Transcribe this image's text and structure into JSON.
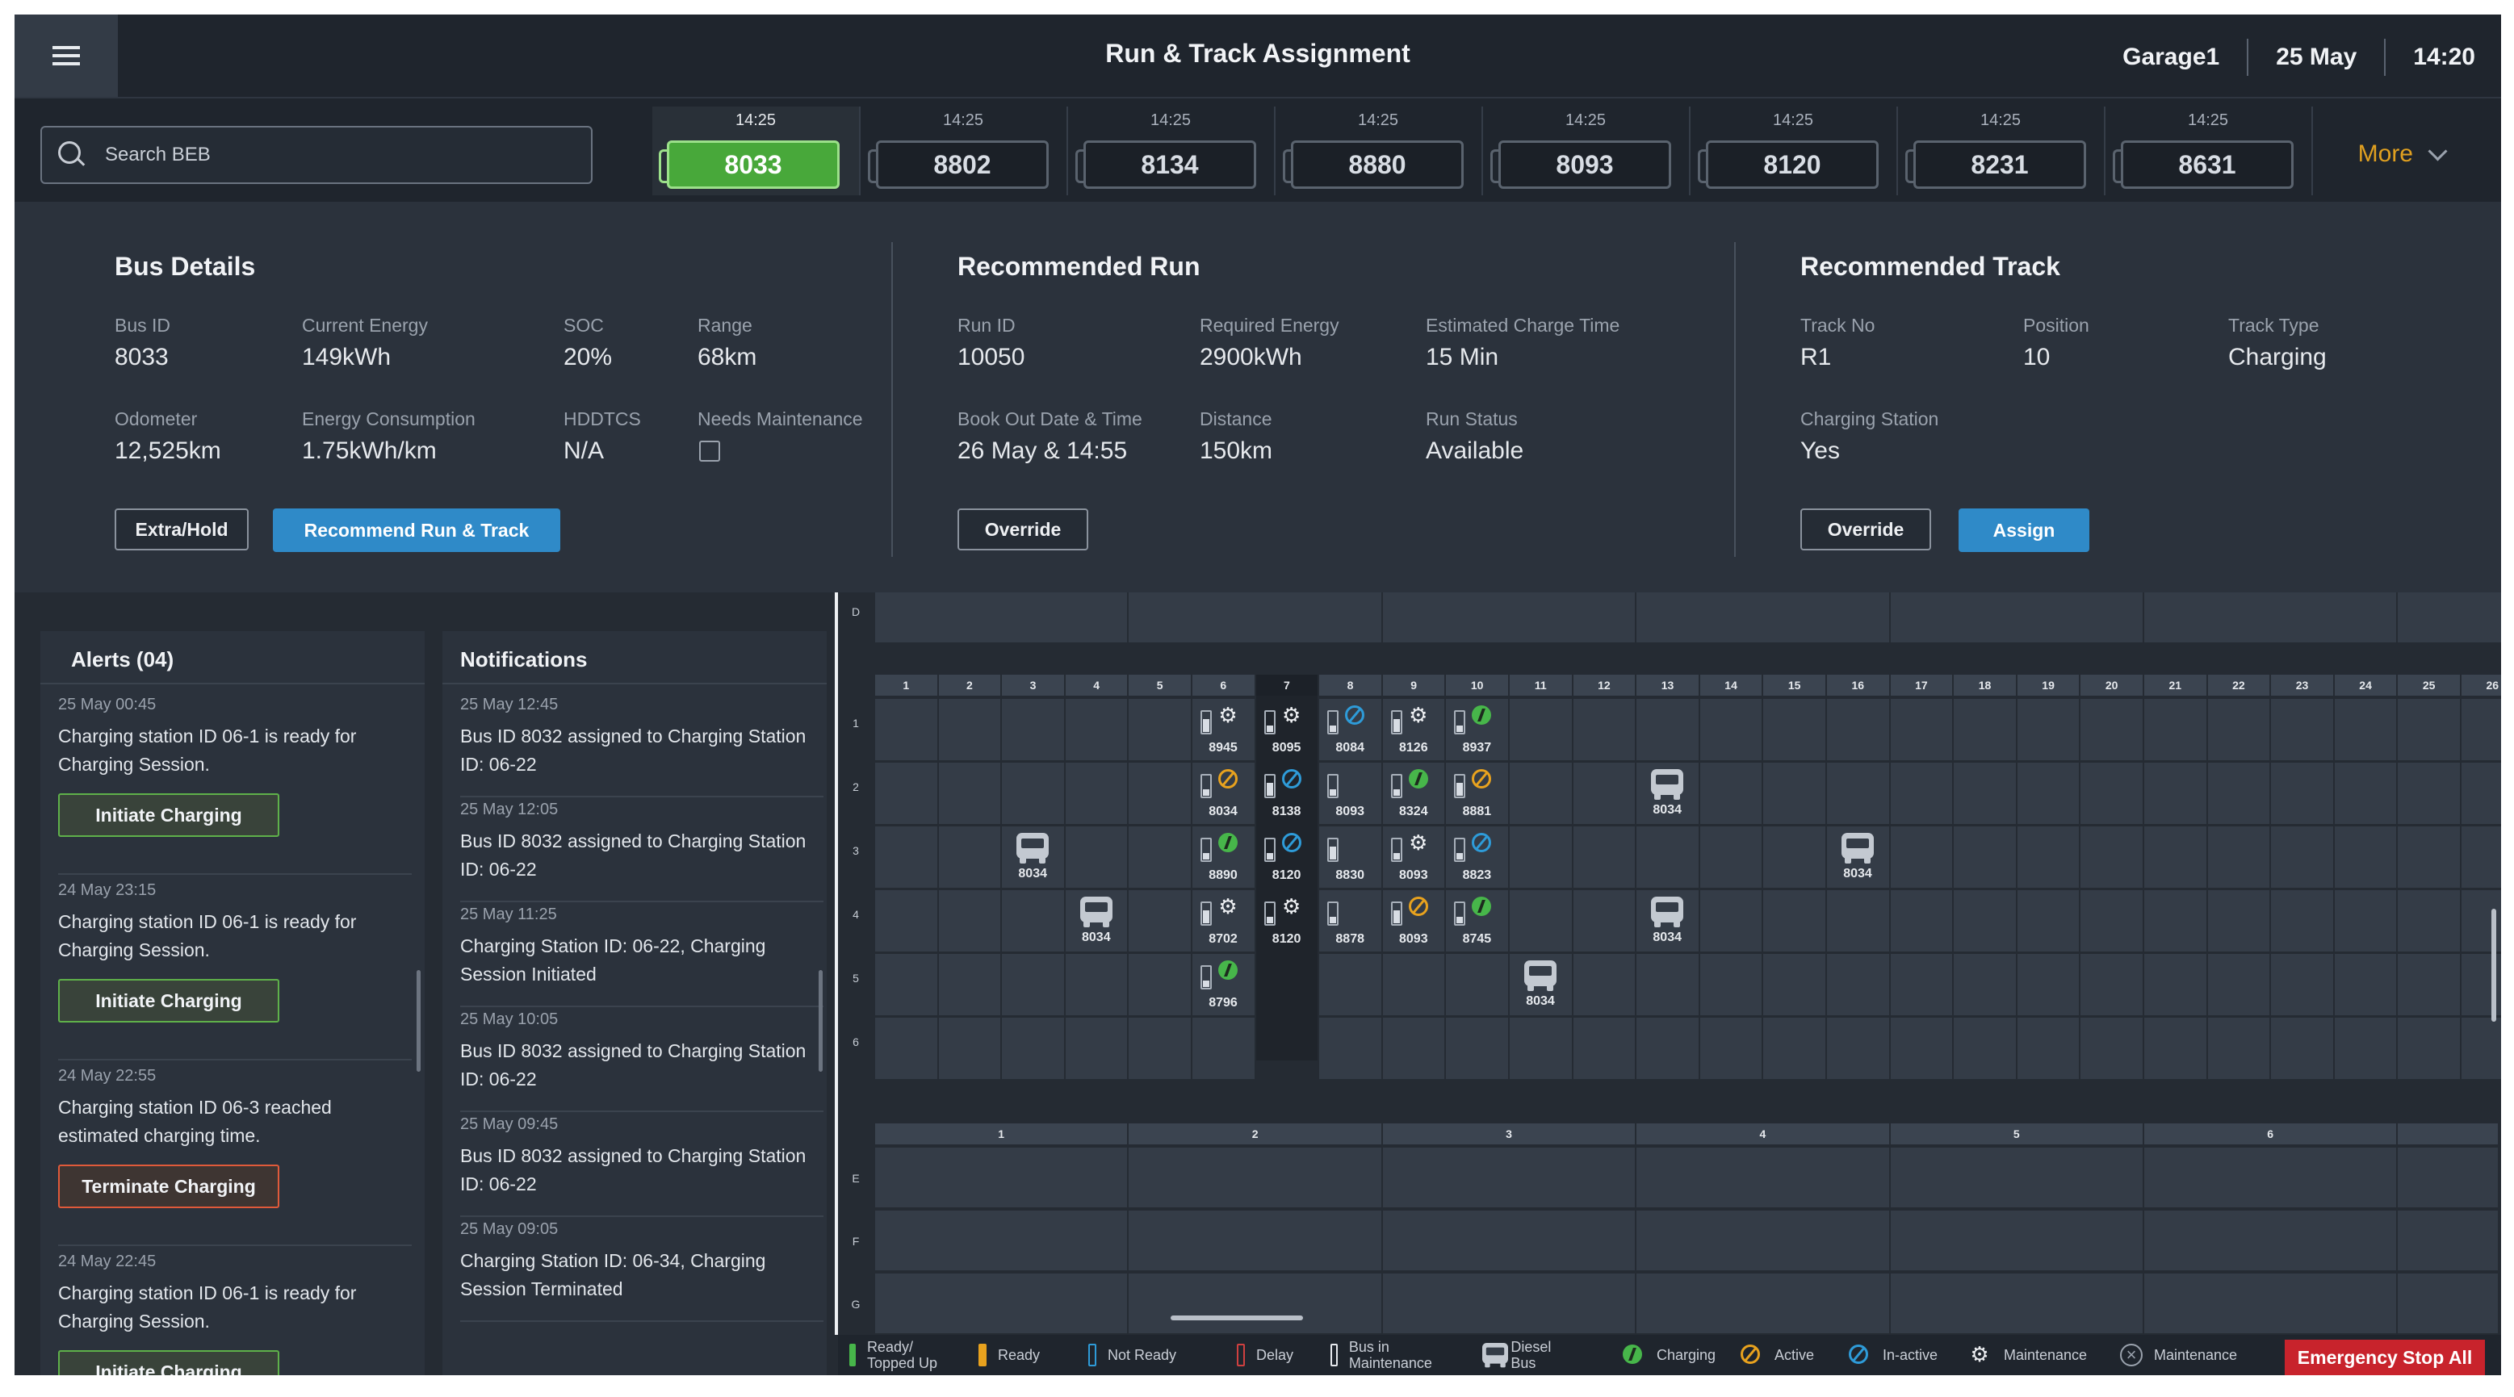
{
  "header": {
    "title": "Run & Track Assignment",
    "garage": "Garage1",
    "date": "25 May",
    "time": "14:20"
  },
  "search": {
    "placeholder": "Search BEB"
  },
  "bus_strip": {
    "buses": [
      {
        "time": "14:25",
        "id": "8033",
        "selected": true
      },
      {
        "time": "14:25",
        "id": "8802"
      },
      {
        "time": "14:25",
        "id": "8134"
      },
      {
        "time": "14:25",
        "id": "8880"
      },
      {
        "time": "14:25",
        "id": "8093"
      },
      {
        "time": "14:25",
        "id": "8120"
      },
      {
        "time": "14:25",
        "id": "8231"
      },
      {
        "time": "14:25",
        "id": "8631"
      }
    ],
    "more_label": "More"
  },
  "bus_details": {
    "title": "Bus Details",
    "fields": [
      {
        "label": "Bus ID",
        "value": "8033"
      },
      {
        "label": "Current Energy",
        "value": "149kWh"
      },
      {
        "label": "SOC",
        "value": "20%"
      },
      {
        "label": "Range",
        "value": "68km"
      },
      {
        "label": "Odometer",
        "value": "12,525km"
      },
      {
        "label": "Energy Consumption",
        "value": "1.75kWh/km"
      },
      {
        "label": "HDDTCS",
        "value": "N/A"
      },
      {
        "label": "Needs Maintenance",
        "value": ""
      }
    ],
    "extra_hold_label": "Extra/Hold",
    "recommend_label": "Recommend Run & Track"
  },
  "recommended_run": {
    "title": "Recommended Run",
    "fields": [
      {
        "label": "Run ID",
        "value": "10050"
      },
      {
        "label": "Required Energy",
        "value": "2900kWh"
      },
      {
        "label": "Estimated Charge Time",
        "value": "15 Min"
      },
      {
        "label": "Book Out Date & Time",
        "value": "26 May & 14:55"
      },
      {
        "label": "Distance",
        "value": "150km"
      },
      {
        "label": "Run Status",
        "value": "Available"
      }
    ],
    "override_label": "Override"
  },
  "recommended_track": {
    "title": "Recommended Track",
    "fields": [
      {
        "label": "Track No",
        "value": "R1"
      },
      {
        "label": "Position",
        "value": "10"
      },
      {
        "label": "Track Type",
        "value": "Charging"
      },
      {
        "label": "Charging Station",
        "value": "Yes"
      }
    ],
    "override_label": "Override",
    "assign_label": "Assign"
  },
  "alerts": {
    "title": "Alerts (04)",
    "items": [
      {
        "time": "25 May 00:45",
        "message": "Charging station ID 06-1 is ready for Charging Session.",
        "action": "Initiate Charging"
      },
      {
        "time": "24 May 23:15",
        "message": "Charging station ID 06-1 is ready for Charging Session.",
        "action": "Initiate Charging"
      },
      {
        "time": "24 May 22:55",
        "message": "Charging station ID 06-3 reached estimated charging time.",
        "action": "Terminate Charging"
      },
      {
        "time": "24 May 22:45",
        "message": "Charging station ID 06-1 is ready for Charging Session.",
        "action": "Initiate Charging"
      }
    ]
  },
  "notifications": {
    "title": "Notifications",
    "items": [
      {
        "time": "25 May 12:45",
        "message": "Bus ID 8032 assigned to Charging Station ID: 06-22"
      },
      {
        "time": "25 May 12:05",
        "message": "Bus ID 8032 assigned to Charging Station ID: 06-22"
      },
      {
        "time": "25 May 11:25",
        "message": "Charging Station ID: 06-22, Charging Session Initiated"
      },
      {
        "time": "25 May 10:05",
        "message": "Bus ID 8032 assigned to Charging Station ID: 06-22"
      },
      {
        "time": "25 May 09:45",
        "message": "Bus ID 8032 assigned to Charging Station ID: 06-22"
      },
      {
        "time": "25 May 09:05",
        "message": "Charging Station ID: 06-34, Charging Session Terminated"
      }
    ]
  },
  "yard": {
    "top_row_label": "D",
    "columns": [
      "1",
      "2",
      "3",
      "4",
      "5",
      "6",
      "7",
      "8",
      "9",
      "10",
      "11",
      "12",
      "13",
      "14",
      "15",
      "16",
      "17",
      "18",
      "19",
      "20",
      "21",
      "22",
      "23",
      "24",
      "25",
      "26"
    ],
    "highlight_column": "7",
    "rows": [
      "1",
      "2",
      "3",
      "4",
      "5",
      "6"
    ],
    "lower_columns": [
      "1",
      "2",
      "3",
      "4",
      "5",
      "6"
    ],
    "lower_rows": [
      "E",
      "F",
      "G"
    ],
    "buses": [
      {
        "id": "8945",
        "row": 1,
        "col": 6,
        "status": "maintenance"
      },
      {
        "id": "8095",
        "row": 1,
        "col": 7,
        "status": "maintenance"
      },
      {
        "id": "8084",
        "row": 1,
        "col": 8,
        "status": "inactive"
      },
      {
        "id": "8126",
        "row": 1,
        "col": 9,
        "status": "maintenance"
      },
      {
        "id": "8937",
        "row": 1,
        "col": 10,
        "status": "charging"
      },
      {
        "id": "8034",
        "row": 2,
        "col": 6,
        "status": "active"
      },
      {
        "id": "8138",
        "row": 2,
        "col": 7,
        "status": "inactive"
      },
      {
        "id": "8093",
        "row": 2,
        "col": 8,
        "status": ""
      },
      {
        "id": "8324",
        "row": 2,
        "col": 9,
        "status": "charging"
      },
      {
        "id": "8881",
        "row": 2,
        "col": 10,
        "status": "active"
      },
      {
        "id": "8890",
        "row": 3,
        "col": 6,
        "status": "charging"
      },
      {
        "id": "8120",
        "row": 3,
        "col": 7,
        "status": "inactive"
      },
      {
        "id": "8830",
        "row": 3,
        "col": 8,
        "status": ""
      },
      {
        "id": "8093",
        "row": 3,
        "col": 9,
        "status": "maintenance"
      },
      {
        "id": "8823",
        "row": 3,
        "col": 10,
        "status": "inactive"
      },
      {
        "id": "8702",
        "row": 4,
        "col": 6,
        "status": "maintenance"
      },
      {
        "id": "8120",
        "row": 4,
        "col": 7,
        "status": "maintenance"
      },
      {
        "id": "8878",
        "row": 4,
        "col": 8,
        "status": ""
      },
      {
        "id": "8093",
        "row": 4,
        "col": 9,
        "status": "active"
      },
      {
        "id": "8745",
        "row": 4,
        "col": 10,
        "status": "charging"
      },
      {
        "id": "8796",
        "row": 5,
        "col": 6,
        "status": "charging"
      }
    ],
    "diesel_buses": [
      {
        "id": "8034",
        "row": 2,
        "col": 13
      },
      {
        "id": "8034",
        "row": 3,
        "col": 3
      },
      {
        "id": "8034",
        "row": 3,
        "col": 16
      },
      {
        "id": "8034",
        "row": 4,
        "col": 4
      },
      {
        "id": "8034",
        "row": 4,
        "col": 13
      },
      {
        "id": "8034",
        "row": 5,
        "col": 11
      }
    ]
  },
  "legend": {
    "ready_topped": "Ready/ Topped Up",
    "ready": "Ready",
    "not_ready": "Not Ready",
    "delay": "Delay",
    "bus_maintenance": "Bus in Maintenance",
    "diesel": "Diesel Bus",
    "charging": "Charging",
    "active": "Active",
    "inactive": "In-active",
    "maintenance": "Maintenance",
    "maintenance2": "Maintenance",
    "emergency_stop": "Emergency Stop All"
  },
  "colors": {
    "accent_blue": "#2f8ac8",
    "ready_green": "#47b64a",
    "active_amber": "#e8a21e",
    "inactive_blue": "#2e9bd8",
    "emergency_red": "#c8232c",
    "more_orange": "#e0a020"
  }
}
